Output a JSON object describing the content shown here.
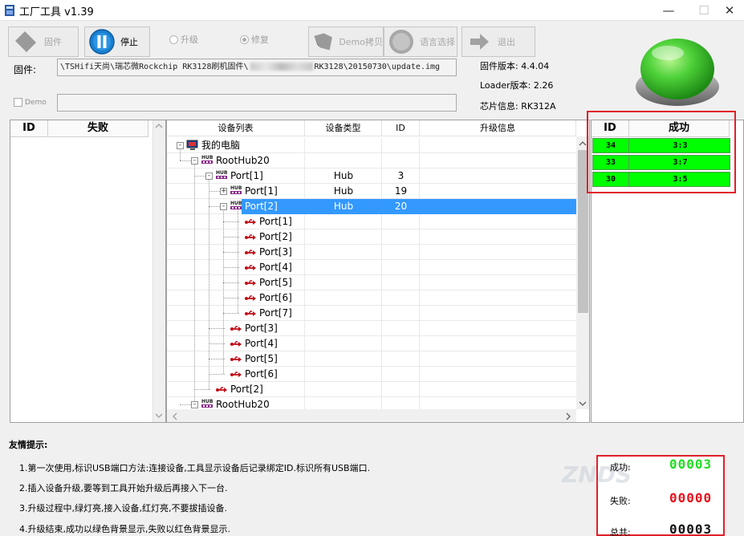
{
  "window": {
    "title": "工厂工具 v1.39",
    "minimize_glyph": "—",
    "maximize_glyph": "☐",
    "close_glyph": "✕"
  },
  "toolbar": {
    "firmware_label": "固件",
    "stop_label": "停止",
    "upgrade_label": "升级",
    "repair_label": "修复",
    "demo_copy_label": "Demo拷贝",
    "language_label": "语言选择",
    "exit_label": "退出"
  },
  "firmware": {
    "label": "固件:",
    "path_before": "\\TSHifi天尚\\瑞芯微Rockchip RK3128刷机固件\\",
    "path_after": "RK3128\\20150730\\update.img",
    "version_label": "固件版本: 4.4.04",
    "loader_label": "Loader版本: 2.26",
    "chip_label": "芯片信息: RK312A"
  },
  "demo": {
    "label": "Demo",
    "path": ""
  },
  "fail_table": {
    "id_header": "ID",
    "fail_header": "失败"
  },
  "device_table": {
    "headers": [
      "设备列表",
      "设备类型",
      "ID",
      "升级信息"
    ],
    "rows": [
      {
        "name": "我的电脑",
        "type": "",
        "id": ""
      },
      {
        "name": "RootHub20",
        "type": "",
        "id": ""
      },
      {
        "name": "Port[1]",
        "type": "Hub",
        "id": "3"
      },
      {
        "name": "Port[1]",
        "type": "Hub",
        "id": "19"
      },
      {
        "name": "Port[2]",
        "type": "Hub",
        "id": "20"
      },
      {
        "name": "Port[1]",
        "type": "",
        "id": ""
      },
      {
        "name": "Port[2]",
        "type": "",
        "id": ""
      },
      {
        "name": "Port[3]",
        "type": "",
        "id": ""
      },
      {
        "name": "Port[4]",
        "type": "",
        "id": ""
      },
      {
        "name": "Port[5]",
        "type": "",
        "id": ""
      },
      {
        "name": "Port[6]",
        "type": "",
        "id": ""
      },
      {
        "name": "Port[7]",
        "type": "",
        "id": ""
      },
      {
        "name": "Port[3]",
        "type": "",
        "id": ""
      },
      {
        "name": "Port[4]",
        "type": "",
        "id": ""
      },
      {
        "name": "Port[5]",
        "type": "",
        "id": ""
      },
      {
        "name": "Port[6]",
        "type": "",
        "id": ""
      },
      {
        "name": "Port[2]",
        "type": "",
        "id": ""
      },
      {
        "name": "RootHub20",
        "type": "",
        "id": ""
      }
    ],
    "hub_icon_text": "HUB"
  },
  "success_table": {
    "id_header": "ID",
    "success_header": "成功",
    "rows": [
      {
        "id": "34",
        "value": "3:3"
      },
      {
        "id": "33",
        "value": "3:7"
      },
      {
        "id": "30",
        "value": "3:5"
      }
    ]
  },
  "tips": {
    "title": "友情提示:",
    "items": [
      "1.第一次使用,标识USB端口方法:连接设备,工具显示设备后记录绑定ID.标识所有USB端口.",
      "2.插入设备升级,要等到工具开始升级后再接入下一台.",
      "3.升级过程中,绿灯亮,接入设备,红灯亮,不要拔插设备.",
      "4.升级结束,成功以绿色背景显示,失败以红色背景显示."
    ]
  },
  "counters": {
    "success_label": "成功:",
    "success_value": "00003",
    "fail_label": "失败:",
    "fail_value": "00000",
    "total_label": "总共:",
    "total_value": "00003"
  },
  "watermark": "ZNDS",
  "colors": {
    "success_green": "#00ff00",
    "counter_green": "#22dd22",
    "counter_red": "#e8101c",
    "selection_blue": "#3399ff",
    "highlight_red": "#e0202a",
    "status_light": "#3ec12a"
  }
}
